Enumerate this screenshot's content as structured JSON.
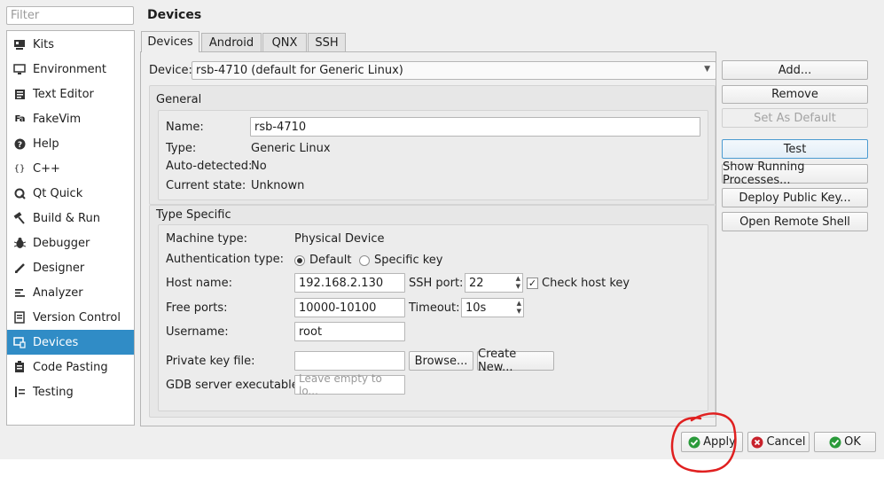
{
  "filter": {
    "placeholder": "Filter"
  },
  "sidebar": {
    "items": [
      {
        "label": "Kits",
        "icon": "kits-icon"
      },
      {
        "label": "Environment",
        "icon": "monitor-icon"
      },
      {
        "label": "Text Editor",
        "icon": "text-editor-icon"
      },
      {
        "label": "FakeVim",
        "icon": "fakevim-icon"
      },
      {
        "label": "Help",
        "icon": "help-icon"
      },
      {
        "label": "C++",
        "icon": "cpp-icon"
      },
      {
        "label": "Qt Quick",
        "icon": "qt-quick-icon"
      },
      {
        "label": "Build & Run",
        "icon": "hammer-icon"
      },
      {
        "label": "Debugger",
        "icon": "bug-icon"
      },
      {
        "label": "Designer",
        "icon": "pen-icon"
      },
      {
        "label": "Analyzer",
        "icon": "analyzer-icon"
      },
      {
        "label": "Version Control",
        "icon": "version-control-icon"
      },
      {
        "label": "Devices",
        "icon": "devices-icon",
        "active": true
      },
      {
        "label": "Code Pasting",
        "icon": "code-pasting-icon"
      },
      {
        "label": "Testing",
        "icon": "testing-icon"
      }
    ]
  },
  "page_title": "Devices",
  "tabs": [
    "Devices",
    "Android",
    "QNX",
    "SSH"
  ],
  "device": {
    "label": "Device:",
    "value": "rsb-4710 (default for Generic Linux)"
  },
  "general": {
    "title": "General",
    "name_label": "Name:",
    "name_value": "rsb-4710",
    "type_label": "Type:",
    "type_value": "Generic Linux",
    "auto_label": "Auto-detected:",
    "auto_value": "No",
    "state_label": "Current state:",
    "state_value": "Unknown"
  },
  "type_specific": {
    "title": "Type Specific",
    "machine_label": "Machine type:",
    "machine_value": "Physical Device",
    "auth_label": "Authentication type:",
    "auth_default": "Default",
    "auth_specific": "Specific key",
    "host_label": "Host name:",
    "host_value": "192.168.2.130",
    "ssh_port_label": "SSH port:",
    "ssh_port_value": "22",
    "check_host_label": "Check host key",
    "free_ports_label": "Free ports:",
    "free_ports_value": "10000-10100",
    "timeout_label": "Timeout:",
    "timeout_value": "10s",
    "username_label": "Username:",
    "username_value": "root",
    "private_key_label": "Private key file:",
    "browse_label": "Browse...",
    "create_new_label": "Create New...",
    "gdb_label": "GDB server executable:",
    "gdb_placeholder": "Leave empty to lo..."
  },
  "side_buttons": {
    "add": "Add...",
    "remove": "Remove",
    "set_default": "Set As Default",
    "test": "Test",
    "show_processes": "Show Running Processes...",
    "deploy_key": "Deploy Public Key...",
    "open_shell": "Open Remote Shell"
  },
  "footer": {
    "apply": "Apply",
    "cancel": "Cancel",
    "ok": "OK"
  },
  "colors": {
    "accent": "#308cc6",
    "annotation": "#e02020",
    "ok_green": "#2a9a3a",
    "cancel_red": "#c8212b"
  }
}
